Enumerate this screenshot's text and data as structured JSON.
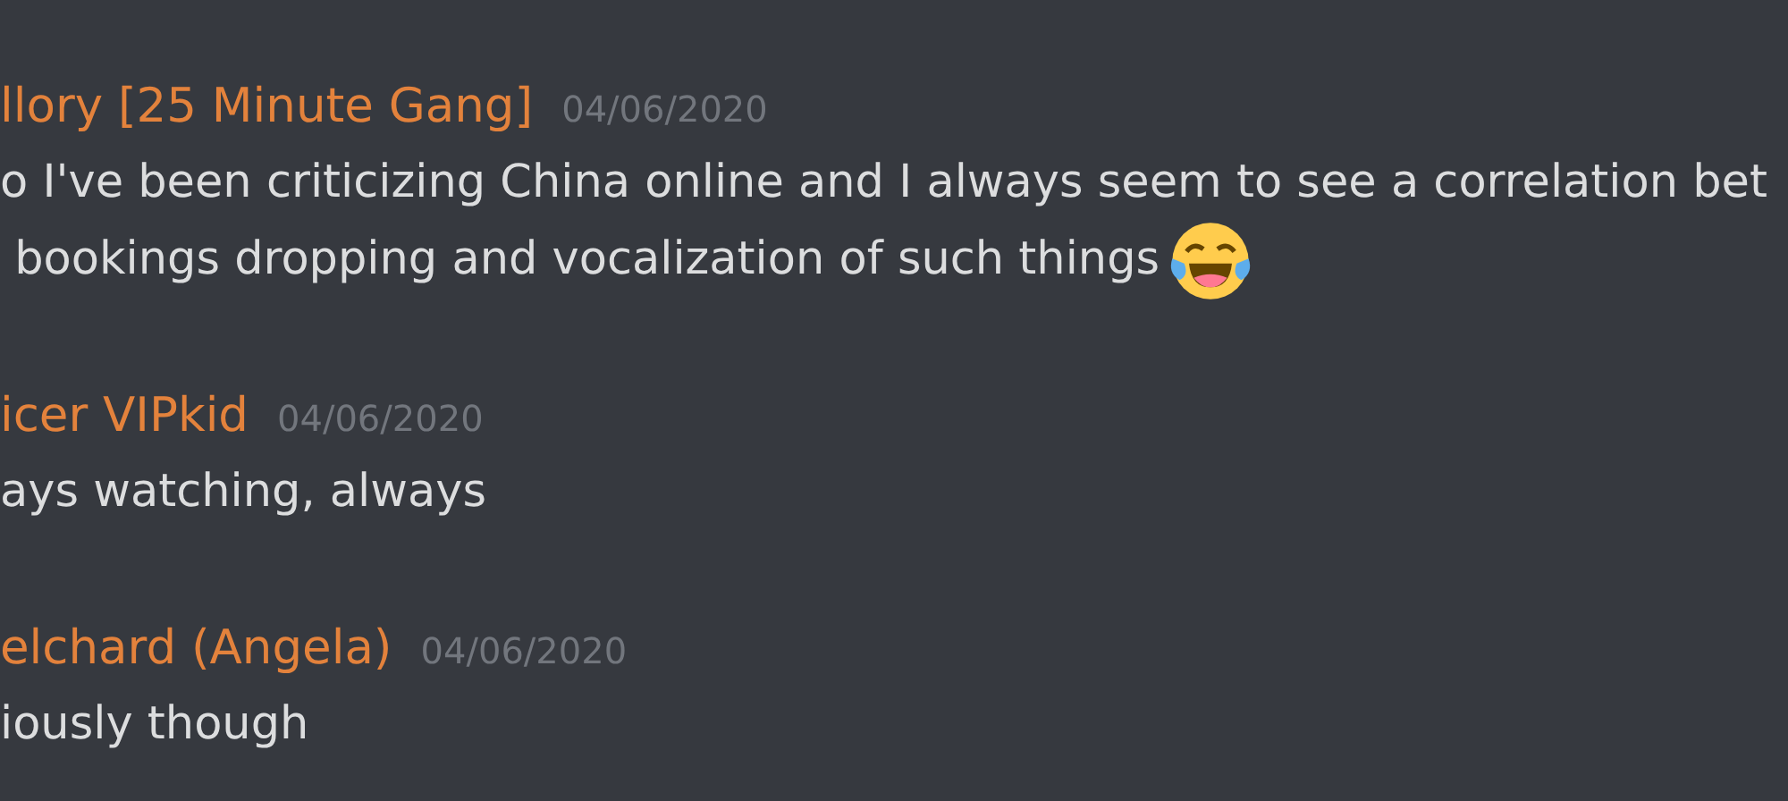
{
  "messages": [
    {
      "author": "llory [25 Minute Gang]",
      "timestamp": "04/06/2020",
      "lines": [
        {
          "text": "o I've been criticizing China online and I always seem to see a correlation bet",
          "trailing_emoji": false
        },
        {
          "text": " bookings dropping and vocalization of such things",
          "trailing_emoji": true
        }
      ]
    },
    {
      "author": "icer VIPkid",
      "timestamp": "04/06/2020",
      "lines": [
        {
          "text": "ays watching, always",
          "trailing_emoji": false
        }
      ]
    },
    {
      "author": "elchard (Angela)",
      "timestamp": "04/06/2020",
      "lines": [
        {
          "text": "iously though",
          "trailing_emoji": false
        }
      ]
    }
  ]
}
